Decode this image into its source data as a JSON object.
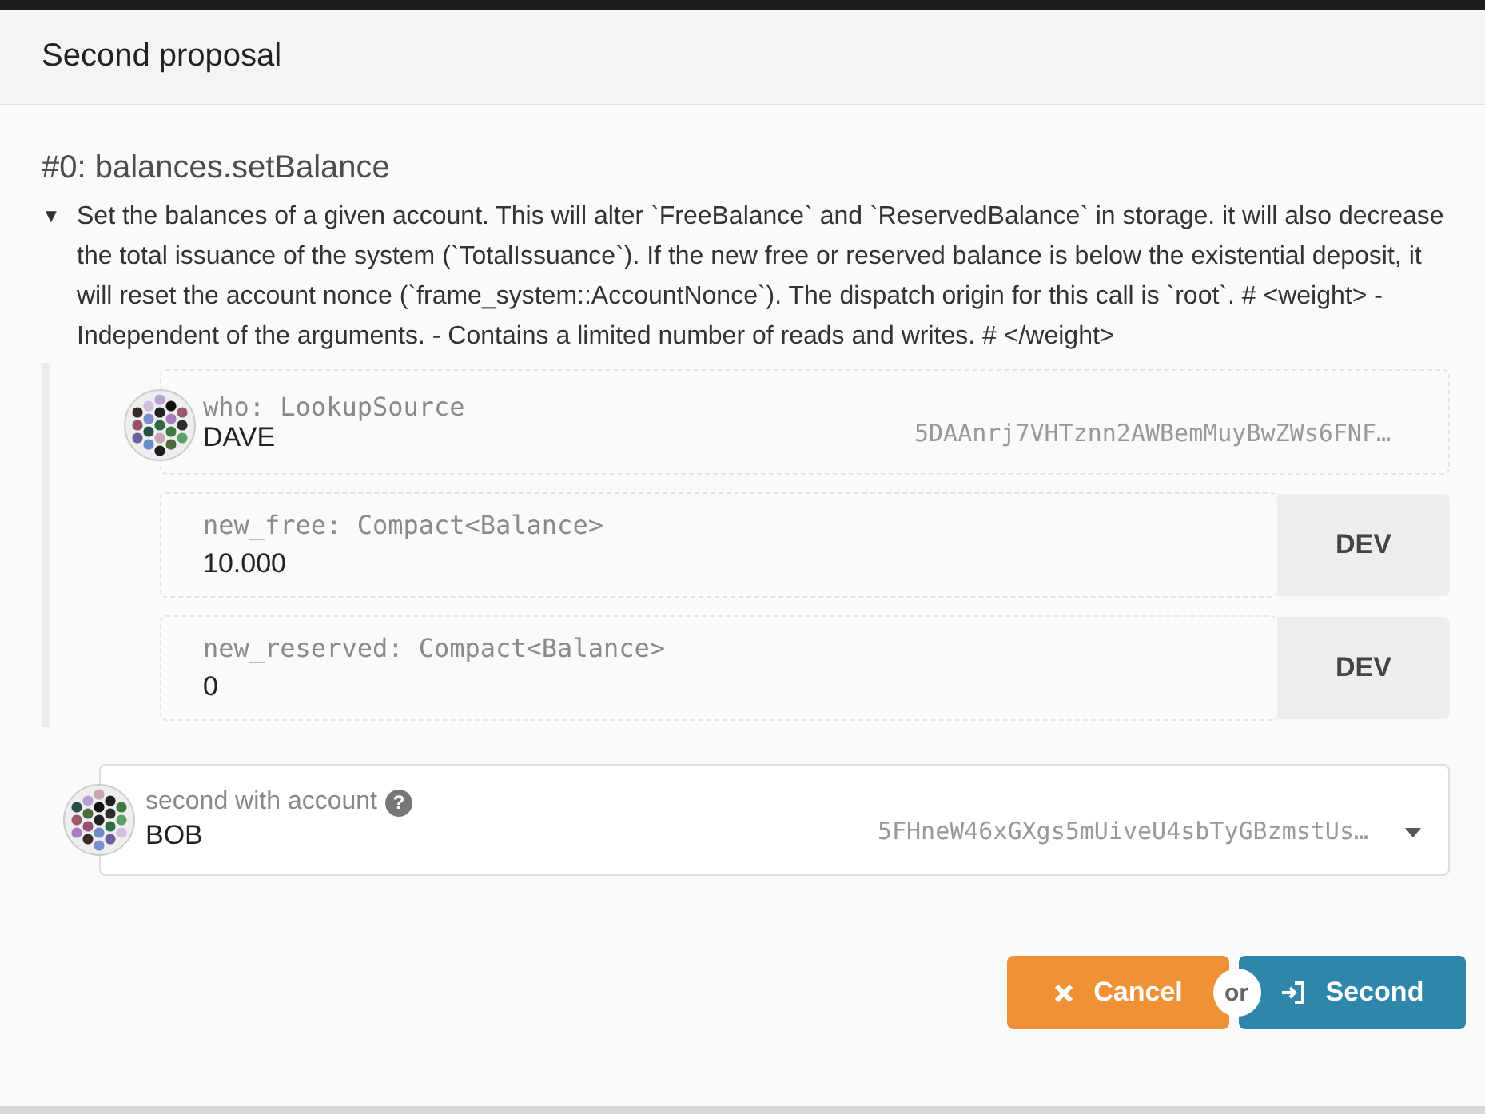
{
  "modal": {
    "title": "Second proposal"
  },
  "call": {
    "title": "#0: balances.setBalance",
    "toggle": "▼",
    "expanded": true,
    "description": "Set the balances of a given account. This will alter `FreeBalance` and `ReservedBalance` in storage. it will also decrease the total issuance of the system (`TotalIssuance`). If the new free or reserved balance is below the existential deposit, it will reset the account nonce (`frame_system::AccountNonce`). The dispatch origin for this call is `root`. # <weight> - Independent of the arguments. - Contains a limited number of reads and writes. # </weight>"
  },
  "params": [
    {
      "kind": "account",
      "label": "who: LookupSource",
      "value": "DAVE",
      "address": "5DAAnrj7VHTznn2AWBemMuyBwZWs6FNF…"
    },
    {
      "kind": "balance",
      "label": "new_free: Compact<Balance>",
      "value": "10.000",
      "unit": "DEV"
    },
    {
      "kind": "balance",
      "label": "new_reserved: Compact<Balance>",
      "value": "0",
      "unit": "DEV"
    }
  ],
  "second_account": {
    "label": "second with account",
    "help": "?",
    "value": "BOB",
    "address": "5FHneW46xGXgs5mUiveU4sbTyGBzmstUs…"
  },
  "actions": {
    "cancel": "Cancel",
    "or": "or",
    "confirm": "Second"
  }
}
